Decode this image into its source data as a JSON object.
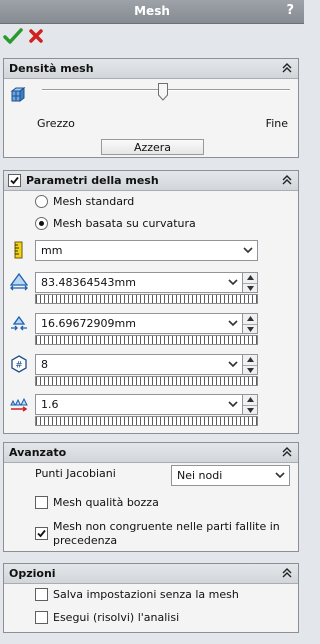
{
  "window": {
    "title": "Mesh",
    "help": "?"
  },
  "toolbar": {
    "ok_icon": "checkmark-icon",
    "cancel_icon": "close-icon"
  },
  "density": {
    "title": "Densità mesh",
    "coarse_label": "Grezzo",
    "fine_label": "Fine",
    "reset_label": "Azzera",
    "slider_level": 0.5
  },
  "params": {
    "title": "Parametri della mesh",
    "radio_standard": "Mesh standard",
    "radio_curvature": "Mesh basata su curvatura",
    "selected": "Mesh basata su curvatura",
    "unit": "mm",
    "max_size": "83.48364543mm",
    "min_size": "16.69672909mm",
    "circle_elements": "8",
    "growth_ratio": "1.6"
  },
  "advanced": {
    "title": "Avanzato",
    "jacobian_label": "Punti Jacobiani",
    "jacobian_value": "Nei nodi",
    "draft_quality": "Mesh qualità bozza",
    "incompatible_line1": "Mesh non congruente nelle parti fallite in",
    "incompatible_line2": "precedenza"
  },
  "options": {
    "title": "Opzioni",
    "save_no_mesh": "Salva impostazioni senza la mesh",
    "run_analysis": "Esegui (risolvi) l'analisi"
  },
  "colors": {
    "titlebar": "#9ea3a9",
    "ok": "#2a9a2a",
    "cancel": "#d02020",
    "accent": "#2060c0"
  }
}
